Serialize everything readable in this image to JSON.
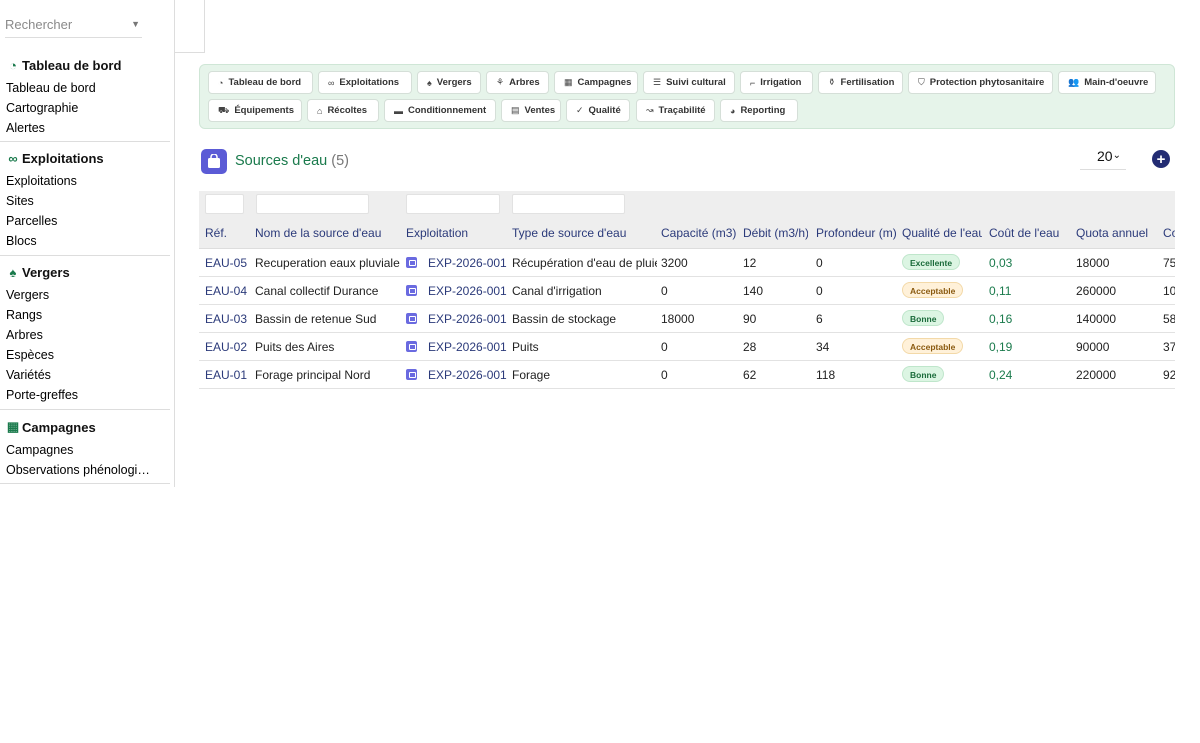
{
  "search": {
    "placeholder": "Rechercher"
  },
  "sidebar": {
    "sections": [
      {
        "title": "Tableau de bord",
        "icon": "gauge-icon",
        "items": [
          "Tableau de bord",
          "Cartographie",
          "Alertes"
        ]
      },
      {
        "title": "Exploitations",
        "icon": "binoculars-icon",
        "items": [
          "Exploitations",
          "Sites",
          "Parcelles",
          "Blocs"
        ]
      },
      {
        "title": "Vergers",
        "icon": "tree-icon",
        "items": [
          "Vergers",
          "Rangs",
          "Arbres",
          "Espèces",
          "Variétés",
          "Porte-greffes"
        ]
      },
      {
        "title": "Campagnes",
        "icon": "calendar-icon",
        "items": [
          "Campagnes",
          "Observations phénologiques"
        ]
      }
    ]
  },
  "nav": {
    "tabs": [
      {
        "label": "Tableau de bord",
        "icon": "gauge-icon",
        "glyph": "◔"
      },
      {
        "label": "Exploitations",
        "icon": "binoculars-icon",
        "glyph": "∞"
      },
      {
        "label": "Vergers",
        "icon": "tree-icon",
        "glyph": "♠"
      },
      {
        "label": "Arbres",
        "icon": "seedling-icon",
        "glyph": "⚘"
      },
      {
        "label": "Campagnes",
        "icon": "calendar-icon",
        "glyph": "▦"
      },
      {
        "label": "Suivi cultural",
        "icon": "list-icon",
        "glyph": "☰"
      },
      {
        "label": "Irrigation",
        "icon": "faucet-icon",
        "glyph": "⌐"
      },
      {
        "label": "Fertilisation",
        "icon": "flask-icon",
        "glyph": "⚱"
      },
      {
        "label": "Protection phytosanitaire",
        "icon": "shield-icon",
        "glyph": "⛉"
      },
      {
        "label": "Main-d'oeuvre",
        "icon": "users-icon",
        "glyph": "👥"
      },
      {
        "label": "Équipements",
        "icon": "tractor-icon",
        "glyph": "⛟"
      },
      {
        "label": "Récoltes",
        "icon": "basket-icon",
        "glyph": "⌂"
      },
      {
        "label": "Conditionnement",
        "icon": "box-icon",
        "glyph": "▬"
      },
      {
        "label": "Ventes",
        "icon": "receipt-icon",
        "glyph": "▤"
      },
      {
        "label": "Qualité",
        "icon": "check-icon",
        "glyph": "✓"
      },
      {
        "label": "Traçabilité",
        "icon": "route-icon",
        "glyph": "↝"
      },
      {
        "label": "Reporting",
        "icon": "chart-pie-icon",
        "glyph": "◕"
      }
    ]
  },
  "page": {
    "title": "Sources d'eau",
    "count": "(5)",
    "page_size": "20"
  },
  "table": {
    "columns": [
      "Réf.",
      "Nom de la source d'eau",
      "Exploitation",
      "Type de source d'eau",
      "Capacité (m3)",
      "Débit (m3/h)",
      "Profondeur (m)",
      "Qualité de l'eau",
      "Coût de l'eau",
      "Quota annuel",
      "Co"
    ],
    "rows": [
      {
        "ref": "EAU-05",
        "name": "Recuperation eaux pluviales",
        "exploitation": "EXP-2026-001",
        "type": "Récupération d'eau de pluie",
        "capacity": "3200",
        "flow": "12",
        "depth": "0",
        "quality": "Excellente",
        "quality_color": "green",
        "cost": "0,03",
        "quota": "18000",
        "extra": "75"
      },
      {
        "ref": "EAU-04",
        "name": "Canal collectif Durance",
        "exploitation": "EXP-2026-001",
        "type": "Canal d'irrigation",
        "capacity": "0",
        "flow": "140",
        "depth": "0",
        "quality": "Acceptable",
        "quality_color": "orange",
        "cost": "0,11",
        "quota": "260000",
        "extra": "10"
      },
      {
        "ref": "EAU-03",
        "name": "Bassin de retenue Sud",
        "exploitation": "EXP-2026-001",
        "type": "Bassin de stockage",
        "capacity": "18000",
        "flow": "90",
        "depth": "6",
        "quality": "Bonne",
        "quality_color": "green",
        "cost": "0,16",
        "quota": "140000",
        "extra": "58"
      },
      {
        "ref": "EAU-02",
        "name": "Puits des Aires",
        "exploitation": "EXP-2026-001",
        "type": "Puits",
        "capacity": "0",
        "flow": "28",
        "depth": "34",
        "quality": "Acceptable",
        "quality_color": "orange",
        "cost": "0,19",
        "quota": "90000",
        "extra": "37"
      },
      {
        "ref": "EAU-01",
        "name": "Forage principal Nord",
        "exploitation": "EXP-2026-001",
        "type": "Forage",
        "capacity": "0",
        "flow": "62",
        "depth": "118",
        "quality": "Bonne",
        "quality_color": "green",
        "cost": "0,24",
        "quota": "220000",
        "extra": "92"
      }
    ]
  },
  "colors": {
    "accent_green": "#1a7a4c",
    "link_blue": "#2b3a7a",
    "add_button": "#232c73",
    "title_icon": "#5b5bd6"
  }
}
